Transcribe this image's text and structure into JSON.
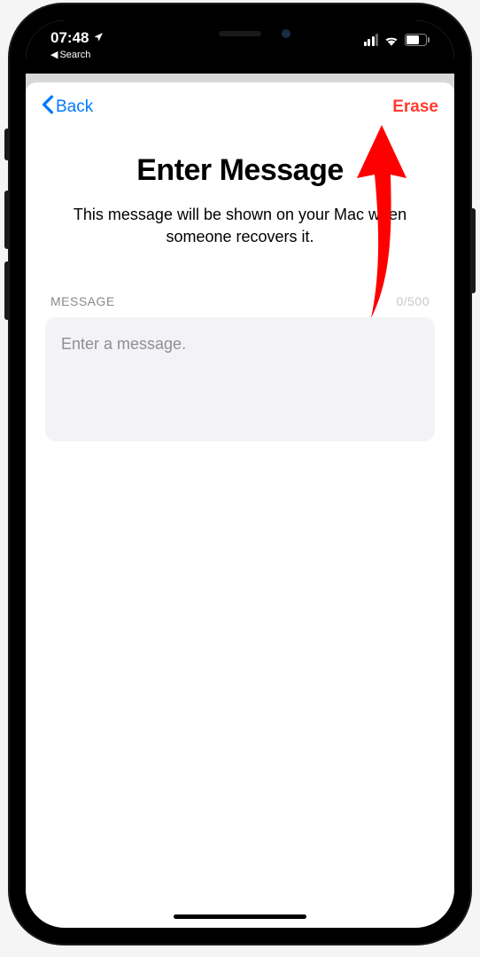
{
  "statusBar": {
    "time": "07:48",
    "backLabel": "Search"
  },
  "nav": {
    "backLabel": "Back",
    "eraseLabel": "Erase"
  },
  "header": {
    "title": "Enter Message",
    "subtitle": "This message will be shown on your Mac when someone recovers it."
  },
  "form": {
    "label": "MESSAGE",
    "counter": "0/500",
    "placeholder": "Enter a message.",
    "value": ""
  }
}
